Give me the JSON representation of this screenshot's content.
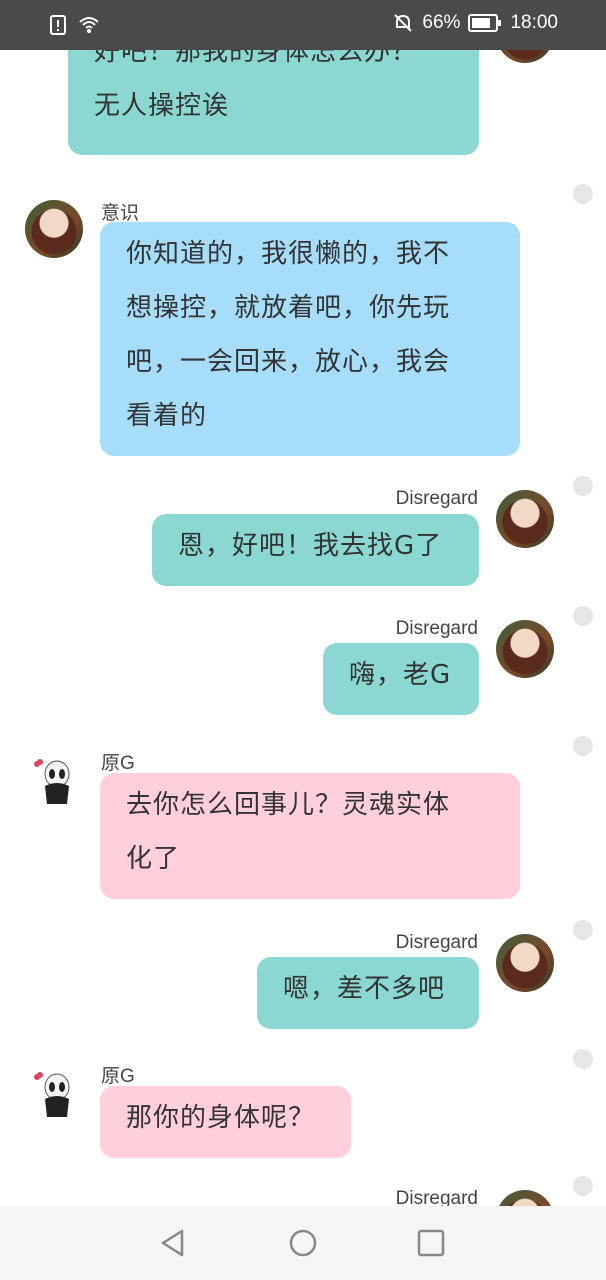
{
  "status_bar": {
    "battery_percent": "66%",
    "time": "18:00",
    "left_icons": [
      "alert-icon",
      "wifi-icon"
    ],
    "right_icons": [
      "mute-bell-icon",
      "battery-icon"
    ]
  },
  "messages": [
    {
      "side": "right",
      "sender": "",
      "avatar": "girl",
      "color": "teal",
      "lines": [
        "好吧！那我的身体怎么办？",
        "无人操控诶"
      ]
    },
    {
      "side": "left",
      "sender": "意识",
      "avatar": "girl",
      "color": "blue",
      "lines": [
        "你知道的，我很懒的，我不",
        "想操控，就放着吧，你先玩",
        "吧，一会回来，放心，我会",
        "看着的"
      ]
    },
    {
      "side": "right",
      "sender": "Disregard",
      "avatar": "girl",
      "color": "teal",
      "lines": [
        "恩，好吧！我去找G了"
      ]
    },
    {
      "side": "right",
      "sender": "Disregard",
      "avatar": "girl",
      "color": "teal",
      "lines": [
        "嗨，老G"
      ]
    },
    {
      "side": "left",
      "sender": "原G",
      "avatar": "ghost",
      "color": "pink",
      "lines": [
        "去你怎么回事儿？灵魂实体",
        "化了"
      ]
    },
    {
      "side": "right",
      "sender": "Disregard",
      "avatar": "girl",
      "color": "teal",
      "lines": [
        "嗯，差不多吧"
      ]
    },
    {
      "side": "left",
      "sender": "原G",
      "avatar": "ghost",
      "color": "pink",
      "lines": [
        "那你的身体呢？"
      ]
    },
    {
      "side": "right",
      "sender": "Disregard",
      "avatar": "girl",
      "color": "teal",
      "lines": []
    }
  ],
  "colors": {
    "teal": "#8ad8d1",
    "blue": "#a6ddfb",
    "pink": "#ffd0da",
    "status_bar": "#4a4a4a"
  },
  "nav_bar": {
    "buttons": [
      "back-triangle-icon",
      "home-circle-icon",
      "recents-square-icon"
    ]
  }
}
